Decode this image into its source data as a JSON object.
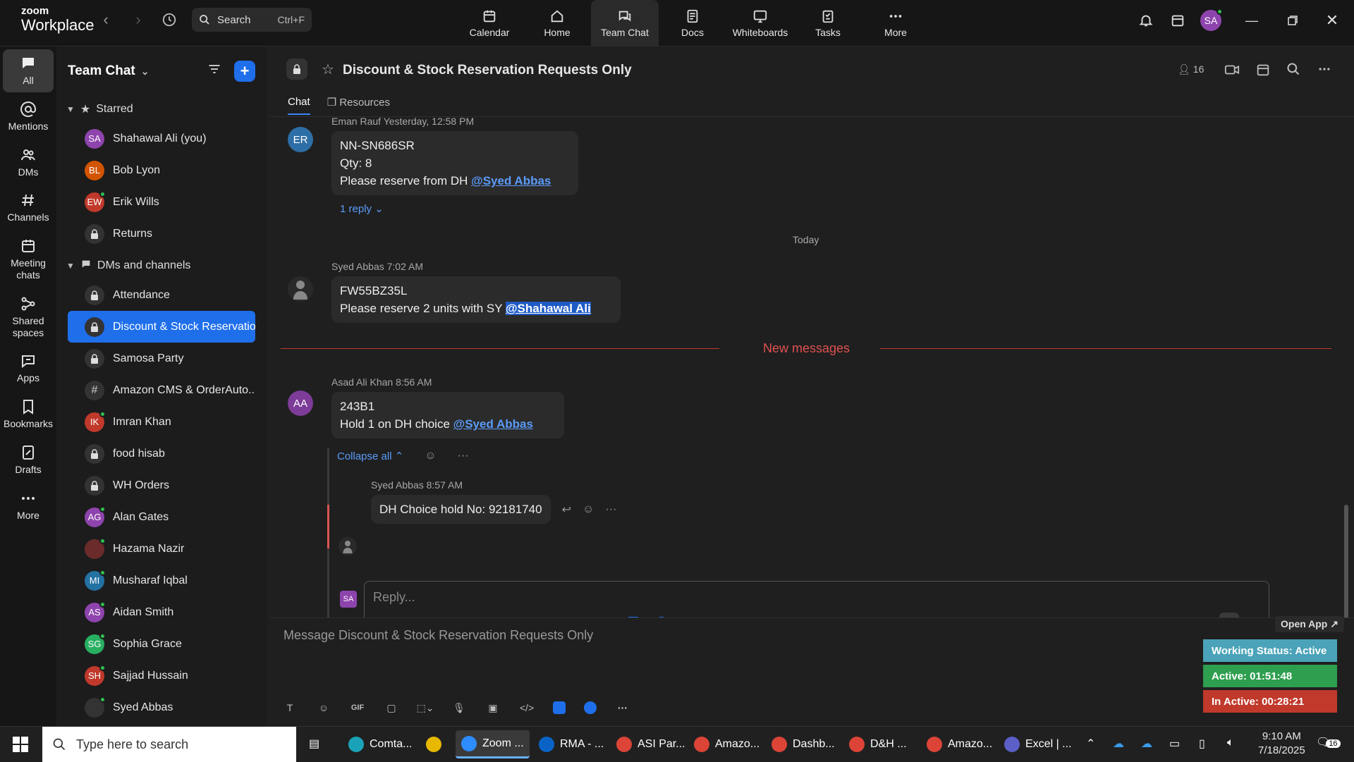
{
  "app": {
    "logo_top": "zoom",
    "logo_bottom": "Workplace"
  },
  "search": {
    "label": "Search",
    "shortcut": "Ctrl+F"
  },
  "tabs": [
    {
      "label": "Calendar"
    },
    {
      "label": "Home"
    },
    {
      "label": "Team Chat"
    },
    {
      "label": "Docs"
    },
    {
      "label": "Whiteboards"
    },
    {
      "label": "Tasks"
    },
    {
      "label": "More"
    }
  ],
  "user": {
    "initials": "SA"
  },
  "rail": [
    {
      "label": "All"
    },
    {
      "label": "Mentions"
    },
    {
      "label": "DMs"
    },
    {
      "label": "Channels"
    },
    {
      "label": "Meeting chats"
    },
    {
      "label": "Shared spaces"
    },
    {
      "label": "Apps"
    },
    {
      "label": "Bookmarks"
    },
    {
      "label": "Drafts"
    },
    {
      "label": "More"
    }
  ],
  "sidebar": {
    "title": "Team Chat",
    "starred_label": "Starred",
    "starred": [
      {
        "initials": "SA",
        "name": "Shahawal Ali (you)",
        "color": "#8e44ad"
      },
      {
        "initials": "BL",
        "name": "Bob Lyon",
        "color": "#d35400"
      },
      {
        "initials": "EW",
        "name": "Erik Wills",
        "color": "#c0392b"
      },
      {
        "name": "Returns"
      }
    ],
    "dm_label": "DMs and channels",
    "dms": [
      {
        "name": "Attendance",
        "kind": "lock"
      },
      {
        "name": "Discount & Stock Reservatio...",
        "kind": "lock",
        "active": true
      },
      {
        "name": "Samosa Party",
        "kind": "lock"
      },
      {
        "name": "Amazon CMS & OrderAuto...",
        "kind": "hash"
      },
      {
        "name": "Imran Khan",
        "initials": "IK",
        "color": "#c0392b"
      },
      {
        "name": "food hisab",
        "kind": "lock"
      },
      {
        "name": "WH Orders",
        "kind": "lock"
      },
      {
        "name": "Alan Gates",
        "initials": "AG",
        "color": "#8e44ad"
      },
      {
        "name": "Hazama Nazir",
        "initials": "",
        "color": "#6b2b2b"
      },
      {
        "name": "Musharaf Iqbal",
        "initials": "MI",
        "color": "#2471a3"
      },
      {
        "name": "Aidan Smith",
        "initials": "AS",
        "color": "#8e44ad"
      },
      {
        "name": "Sophia Grace",
        "initials": "SG",
        "color": "#27ae60"
      },
      {
        "name": "Sajjad Hussain",
        "initials": "SH",
        "color": "#c0392b"
      },
      {
        "name": "Syed Abbas",
        "initials": "",
        "color": "#333"
      }
    ]
  },
  "channel": {
    "title": "Discount & Stock Reservation Requests Only",
    "members": "16",
    "tab_chat": "Chat",
    "tab_resources": "Resources"
  },
  "messages": {
    "m1": {
      "initials": "ER",
      "sender": "Eman Rauf",
      "time": "Yesterday, 12:58 PM",
      "l1": "NN-SN686SR",
      "l2": "Qty: 8",
      "l3": "Please reserve from DH ",
      "mention": "@Syed Abbas",
      "reply": "1 reply"
    },
    "divider_today": "Today",
    "m2": {
      "sender": "Syed Abbas",
      "time": "7:02 AM",
      "l1": "FW55BZ35L",
      "l2": "Please reserve 2 units with SY ",
      "mention": "@Shahawal Ali"
    },
    "new_messages": "New messages",
    "m3": {
      "initials": "AA",
      "sender": "Asad Ali Khan",
      "time": "8:56 AM",
      "l1": "243B1",
      "l2": "Hold 1 on DH choice ",
      "mention": "@Syed Abbas",
      "collapse": "Collapse all"
    },
    "m4": {
      "sender": "Syed Abbas",
      "time": "8:57 AM",
      "text": "DH Choice hold No: 92181740"
    },
    "reply_placeholder": "Reply...",
    "reply_avatar": "SA"
  },
  "composer": {
    "placeholder": "Message Discount & Stock Reservation Requests Only",
    "gif": "GIF"
  },
  "widget": {
    "open_app": "Open App ↗",
    "working": "Working Status: Active",
    "active": "Active: 01:51:48",
    "inactive": "In Active: 00:28:21"
  },
  "taskbar": {
    "search": "Type here to search",
    "apps": [
      "Comta...",
      "",
      "Zoom ...",
      "RMA - ...",
      "ASI Par...",
      "Amazo...",
      "Dashb...",
      "D&H ...",
      "Amazo...",
      "Excel | ..."
    ],
    "time": "9:10 AM",
    "date": "7/18/2025",
    "notif": "16"
  }
}
